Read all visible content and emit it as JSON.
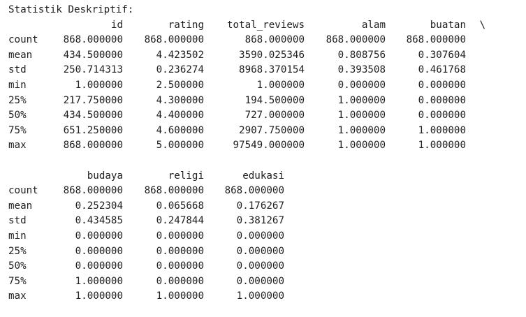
{
  "heading": "Statistik Deskriptif:",
  "table1": {
    "columns": [
      "id",
      "rating",
      "total_reviews",
      "alam",
      "buatan"
    ],
    "continuation": "\\",
    "rows": [
      {
        "label": "count",
        "values": [
          "868.000000",
          "868.000000",
          "868.000000",
          "868.000000",
          "868.000000"
        ]
      },
      {
        "label": "mean",
        "values": [
          "434.500000",
          "4.423502",
          "3590.025346",
          "0.808756",
          "0.307604"
        ]
      },
      {
        "label": "std",
        "values": [
          "250.714313",
          "0.236274",
          "8968.370154",
          "0.393508",
          "0.461768"
        ]
      },
      {
        "label": "min",
        "values": [
          "1.000000",
          "2.500000",
          "1.000000",
          "0.000000",
          "0.000000"
        ]
      },
      {
        "label": "25%",
        "values": [
          "217.750000",
          "4.300000",
          "194.500000",
          "1.000000",
          "0.000000"
        ]
      },
      {
        "label": "50%",
        "values": [
          "434.500000",
          "4.400000",
          "727.000000",
          "1.000000",
          "0.000000"
        ]
      },
      {
        "label": "75%",
        "values": [
          "651.250000",
          "4.600000",
          "2907.750000",
          "1.000000",
          "1.000000"
        ]
      },
      {
        "label": "max",
        "values": [
          "868.000000",
          "5.000000",
          "97549.000000",
          "1.000000",
          "1.000000"
        ]
      }
    ]
  },
  "table2": {
    "columns": [
      "budaya",
      "religi",
      "edukasi"
    ],
    "rows": [
      {
        "label": "count",
        "values": [
          "868.000000",
          "868.000000",
          "868.000000"
        ]
      },
      {
        "label": "mean",
        "values": [
          "0.252304",
          "0.065668",
          "0.176267"
        ]
      },
      {
        "label": "std",
        "values": [
          "0.434585",
          "0.247844",
          "0.381267"
        ]
      },
      {
        "label": "min",
        "values": [
          "0.000000",
          "0.000000",
          "0.000000"
        ]
      },
      {
        "label": "25%",
        "values": [
          "0.000000",
          "0.000000",
          "0.000000"
        ]
      },
      {
        "label": "50%",
        "values": [
          "0.000000",
          "0.000000",
          "0.000000"
        ]
      },
      {
        "label": "75%",
        "values": [
          "1.000000",
          "0.000000",
          "0.000000"
        ]
      },
      {
        "label": "max",
        "values": [
          "1.000000",
          "1.000000",
          "1.000000"
        ]
      }
    ]
  }
}
